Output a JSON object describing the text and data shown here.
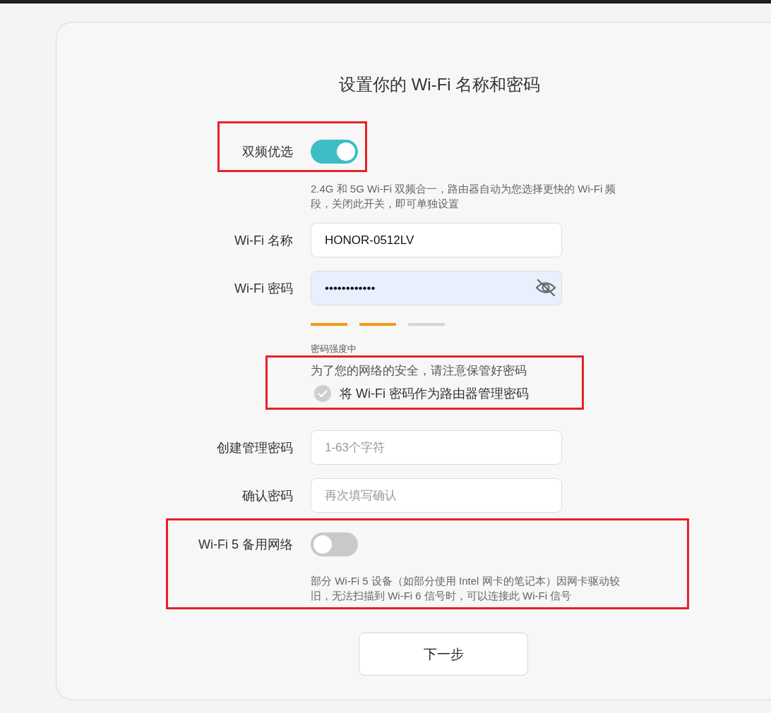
{
  "title": "设置你的 Wi-Fi 名称和密码",
  "dual_band": {
    "label": "双频优选",
    "on": true,
    "highlighted": true,
    "description": "2.4G 和 5G Wi-Fi 双频合一，路由器自动为您选择更快的 Wi-Fi 频段，关闭此开关，即可单独设置"
  },
  "wifi_name": {
    "label": "Wi-Fi 名称",
    "value": "HONOR-0512LV"
  },
  "wifi_password": {
    "label": "Wi-Fi 密码",
    "value": "••••••••••••",
    "autofilled": true
  },
  "password_strength": {
    "label": "密码强度中",
    "segments": [
      {
        "filled": true
      },
      {
        "filled": true
      },
      {
        "filled": false
      }
    ]
  },
  "security_note": {
    "text": "为了您的网络的安全，请注意保管好密码",
    "highlighted": true,
    "use_as_admin": {
      "label": "将 Wi-Fi 密码作为路由器管理密码",
      "checked": false
    }
  },
  "admin_password": {
    "label": "创建管理密码",
    "placeholder": "1-63个字符"
  },
  "confirm_password": {
    "label": "确认密码",
    "placeholder": "再次填写确认"
  },
  "wifi5_backup": {
    "label": "Wi-Fi 5 备用网络",
    "on": false,
    "highlighted": true,
    "description": "部分 Wi-Fi 5 设备（如部分使用 Intel 网卡的笔记本）因网卡驱动较旧，无法扫描到 Wi-Fi 6 信号时，可以连接此 Wi-Fi 信号"
  },
  "next_button": "下一步"
}
